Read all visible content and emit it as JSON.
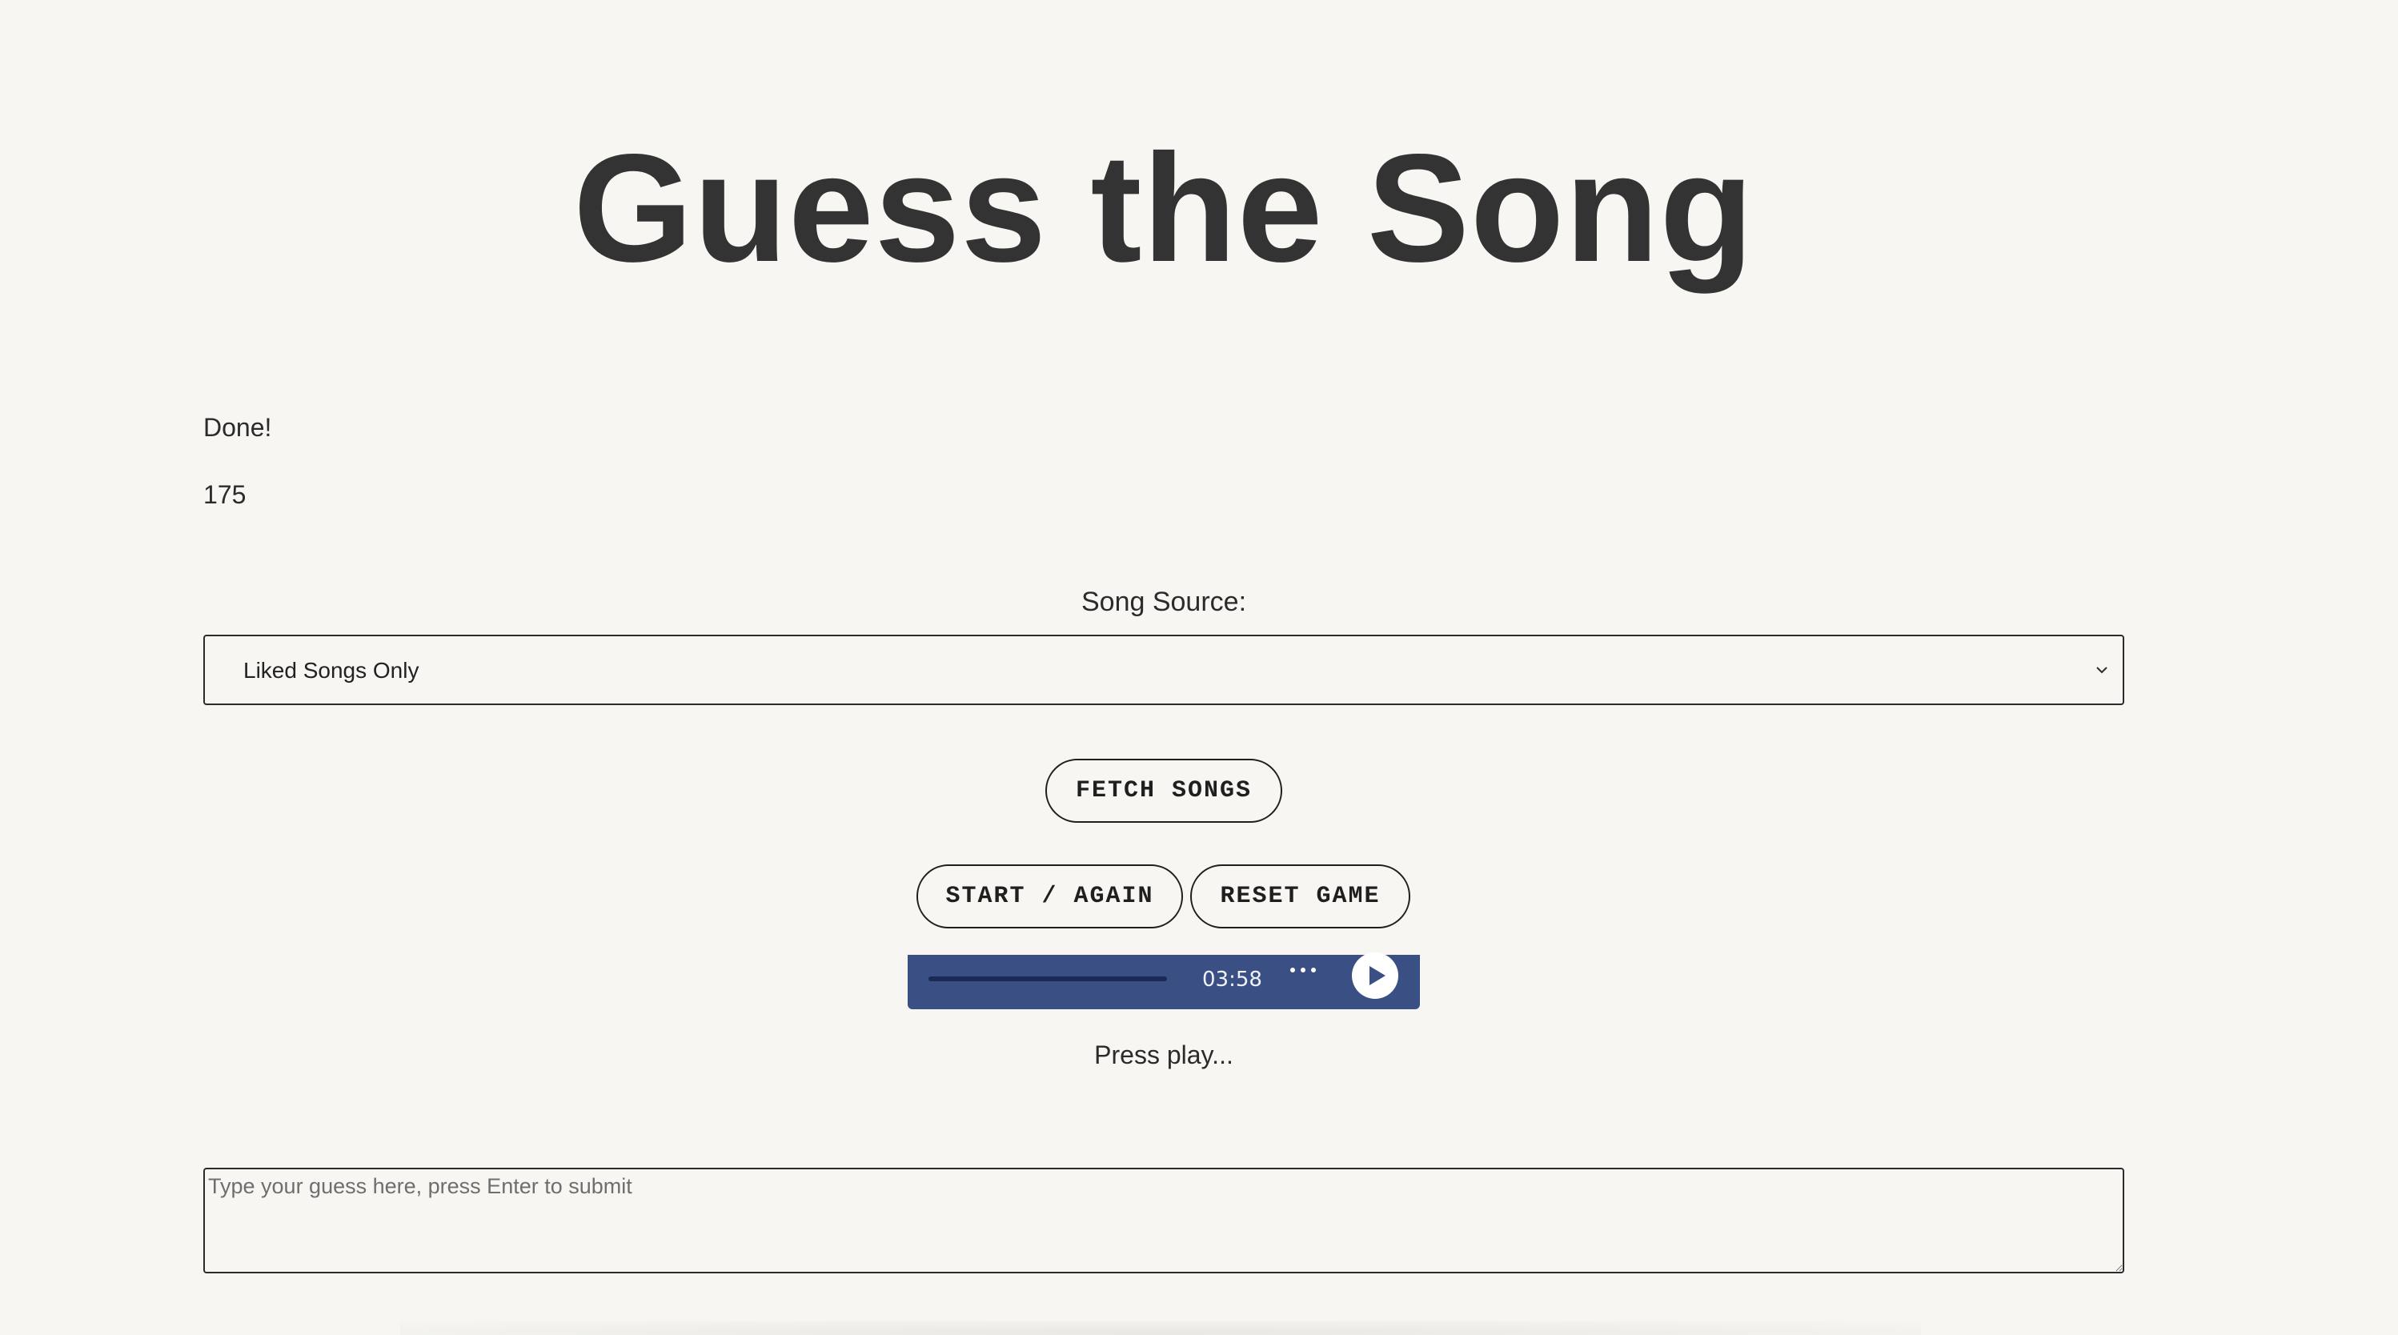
{
  "header": {
    "title": "Guess the Song"
  },
  "status": {
    "message": "Done!",
    "count": "175"
  },
  "source": {
    "label": "Song Source:",
    "selected": "Liked Songs Only"
  },
  "buttons": {
    "fetch": "FETCH SONGS",
    "start": "START / AGAIN",
    "reset": "RESET GAME"
  },
  "player": {
    "time": "03:58",
    "progress": 0,
    "more_icon": "more-icon",
    "play_icon": "play-icon",
    "accent_color": "#3a5084"
  },
  "hint": "Press play...",
  "guess": {
    "placeholder": "Type your guess here, press Enter to submit",
    "value": ""
  }
}
